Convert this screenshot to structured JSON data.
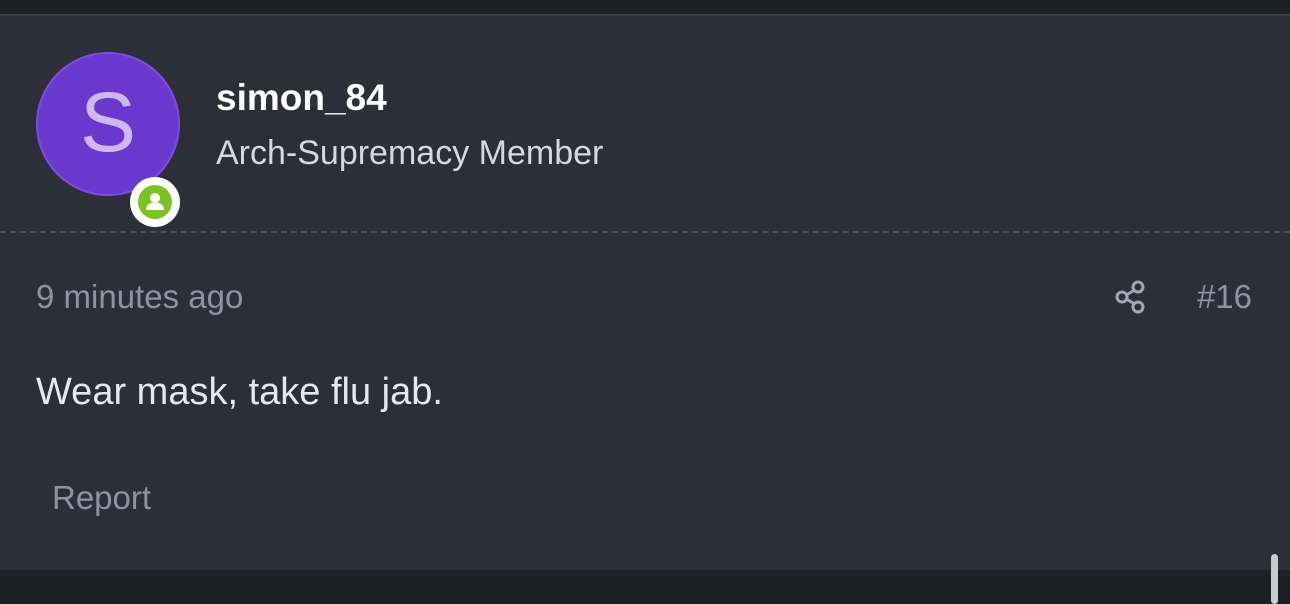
{
  "post": {
    "author": {
      "avatar_letter": "S",
      "avatar_color": "#6a38cf",
      "online_status_color": "#7cc226",
      "online_icon": "user-circle-icon",
      "username": "simon_84",
      "title": "Arch-Supremacy Member"
    },
    "timestamp": "9 minutes ago",
    "share_icon": "share-icon",
    "number": "#16",
    "body": "Wear mask, take flu jab.",
    "report_label": "Report"
  }
}
